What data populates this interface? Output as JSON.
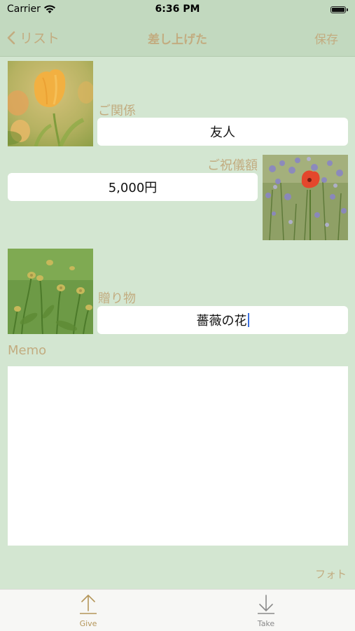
{
  "status": {
    "carrier": "Carrier",
    "time": "6:36 PM"
  },
  "nav": {
    "back_label": "リスト",
    "title": "差し上げた",
    "save_label": "保存"
  },
  "form": {
    "relation_label": "ご関係",
    "relation_value": "友人",
    "amount_label": "ご祝儀額",
    "amount_value": "5,000円",
    "gift_label": "贈り物",
    "gift_value": "薔薇の花",
    "memo_label": "Memo",
    "memo_value": "",
    "photo_link": "フォト"
  },
  "tabs": [
    {
      "label": "Give",
      "icon": "arrow-up-icon",
      "active": true
    },
    {
      "label": "Take",
      "icon": "arrow-down-icon",
      "active": false
    }
  ],
  "colors": {
    "background": "#d3e6d1",
    "accent": "#c2ac80",
    "bar": "#c2d9bf",
    "tab_active": "#b4965a",
    "tab_inactive": "#8a8a8a"
  }
}
